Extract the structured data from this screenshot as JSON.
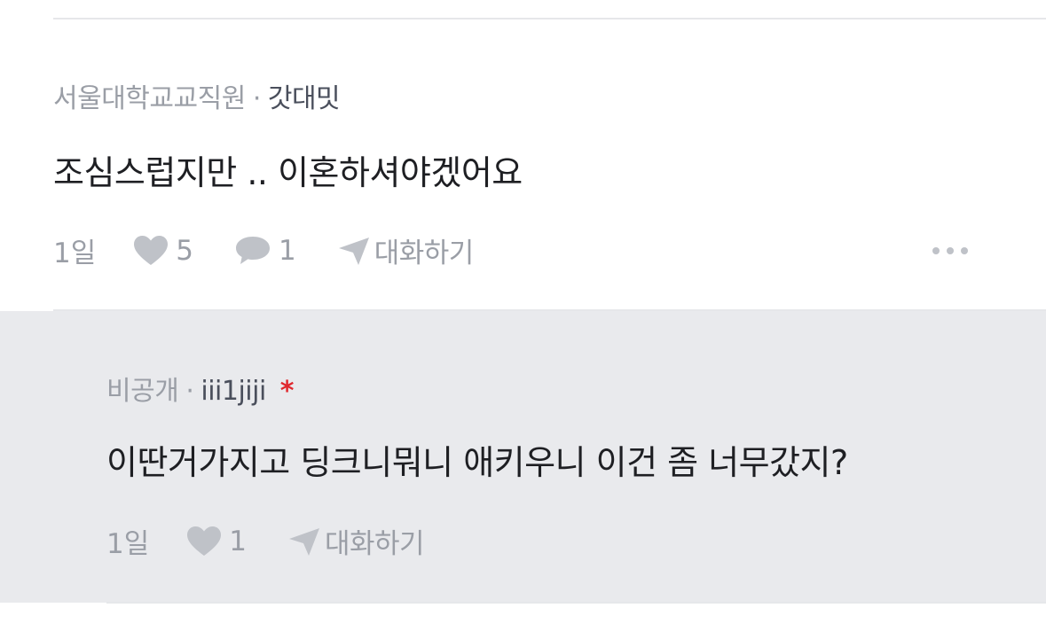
{
  "comment": {
    "author": "서울대학교교직원",
    "separator": "·",
    "nickname": "갓대밋",
    "text": "조심스럽지만 .. 이혼하셔야겠어요",
    "date": "1일",
    "likes": "5",
    "replies": "1",
    "chat_label": "대화하기"
  },
  "reply": {
    "author": "비공개",
    "separator": "·",
    "nickname": "iii1jiji",
    "mark": "*",
    "text": "이딴거가지고 딩크니뭐니 애키우니 이건 좀 너무갔지?",
    "date": "1일",
    "likes": "1",
    "chat_label": "대화하기"
  },
  "icons": {
    "like": "heart-icon",
    "comment": "speech-bubble-icon",
    "chat": "paper-plane-icon",
    "more": "more-dots-icon"
  },
  "colors": {
    "icon_gray": "#bfc2c8",
    "reply_background": "#e9eaed",
    "author_mark": "#e0282e"
  }
}
